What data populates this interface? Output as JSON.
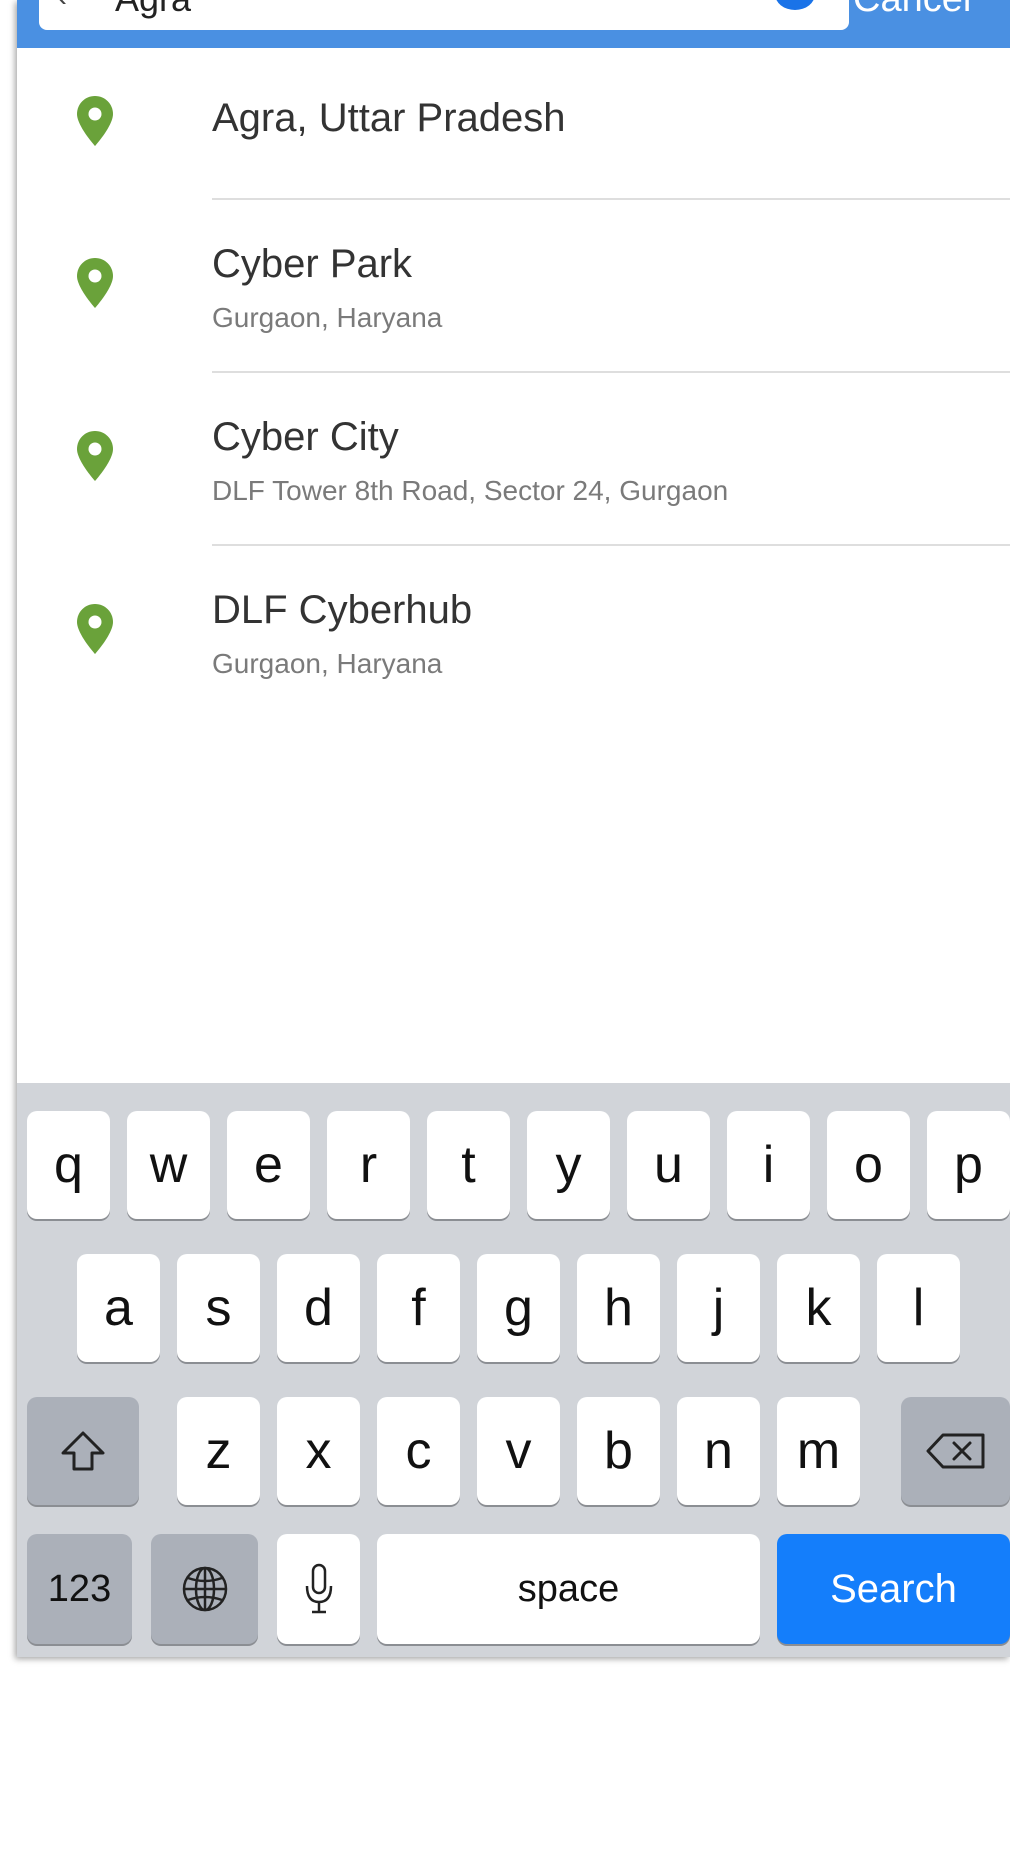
{
  "search": {
    "back_icon": "chevron-left-icon",
    "query": "Agra",
    "cancel_label": "Cancel"
  },
  "results": [
    {
      "title": "Agra, Uttar Pradesh",
      "subtitle": ""
    },
    {
      "title": "Cyber Park",
      "subtitle": "Gurgaon, Haryana"
    },
    {
      "title": "Cyber City",
      "subtitle": "DLF Tower 8th Road, Sector 24, Gurgaon"
    },
    {
      "title": "DLF Cyberhub",
      "subtitle": "Gurgaon, Haryana"
    }
  ],
  "colors": {
    "header": "#4a90e2",
    "pin": "#6aa23a",
    "search_key": "#147efb"
  },
  "keyboard": {
    "row1": [
      "q",
      "w",
      "e",
      "r",
      "t",
      "y",
      "u",
      "i",
      "o",
      "p"
    ],
    "row2": [
      "a",
      "s",
      "d",
      "f",
      "g",
      "h",
      "j",
      "k",
      "l"
    ],
    "row3": [
      "z",
      "x",
      "c",
      "v",
      "b",
      "n",
      "m"
    ],
    "numbers_label": "123",
    "space_label": "space",
    "search_label": "Search",
    "shift_icon": "shift-icon",
    "backspace_icon": "backspace-icon",
    "globe_icon": "globe-icon",
    "mic_icon": "microphone-icon"
  }
}
